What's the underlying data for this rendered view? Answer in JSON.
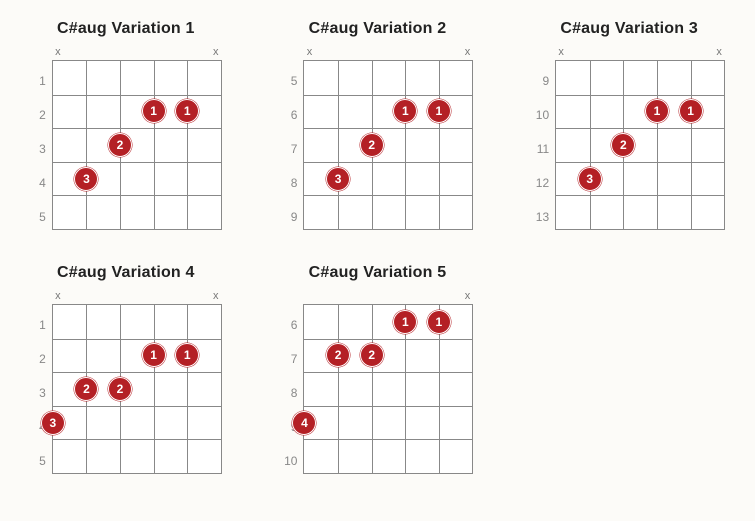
{
  "chart_data": [
    {
      "type": "table",
      "title": "C#aug Variation 1",
      "frets": [
        1,
        2,
        3,
        4,
        5
      ],
      "mutes": [
        "x",
        "",
        "",
        "",
        "",
        "x"
      ],
      "dots": [
        {
          "string": 4,
          "fret": 2,
          "finger": "1"
        },
        {
          "string": 5,
          "fret": 2,
          "finger": "1"
        },
        {
          "string": 3,
          "fret": 3,
          "finger": "2"
        },
        {
          "string": 2,
          "fret": 4,
          "finger": "3"
        }
      ]
    },
    {
      "type": "table",
      "title": "C#aug Variation 2",
      "frets": [
        5,
        6,
        7,
        8,
        9
      ],
      "mutes": [
        "x",
        "",
        "",
        "",
        "",
        "x"
      ],
      "dots": [
        {
          "string": 4,
          "fret": 6,
          "finger": "1"
        },
        {
          "string": 5,
          "fret": 6,
          "finger": "1"
        },
        {
          "string": 3,
          "fret": 7,
          "finger": "2"
        },
        {
          "string": 2,
          "fret": 8,
          "finger": "3"
        }
      ]
    },
    {
      "type": "table",
      "title": "C#aug Variation 3",
      "frets": [
        9,
        10,
        11,
        12,
        13
      ],
      "mutes": [
        "x",
        "",
        "",
        "",
        "",
        "x"
      ],
      "dots": [
        {
          "string": 4,
          "fret": 10,
          "finger": "1"
        },
        {
          "string": 5,
          "fret": 10,
          "finger": "1"
        },
        {
          "string": 3,
          "fret": 11,
          "finger": "2"
        },
        {
          "string": 2,
          "fret": 12,
          "finger": "3"
        }
      ]
    },
    {
      "type": "table",
      "title": "C#aug Variation 4",
      "frets": [
        1,
        2,
        3,
        4,
        5
      ],
      "mutes": [
        "x",
        "",
        "",
        "",
        "",
        "x"
      ],
      "dots": [
        {
          "string": 4,
          "fret": 2,
          "finger": "1"
        },
        {
          "string": 5,
          "fret": 2,
          "finger": "1"
        },
        {
          "string": 2,
          "fret": 3,
          "finger": "2"
        },
        {
          "string": 3,
          "fret": 3,
          "finger": "2"
        },
        {
          "string": 1,
          "fret": 4,
          "finger": "3"
        }
      ]
    },
    {
      "type": "table",
      "title": "C#aug Variation 5",
      "frets": [
        6,
        7,
        8,
        9,
        10
      ],
      "mutes": [
        "",
        "",
        "",
        "",
        "",
        "x"
      ],
      "dots": [
        {
          "string": 4,
          "fret": 6,
          "finger": "1"
        },
        {
          "string": 5,
          "fret": 6,
          "finger": "1"
        },
        {
          "string": 2,
          "fret": 7,
          "finger": "2"
        },
        {
          "string": 3,
          "fret": 7,
          "finger": "2"
        },
        {
          "string": 1,
          "fret": 9,
          "finger": "4"
        }
      ]
    }
  ]
}
